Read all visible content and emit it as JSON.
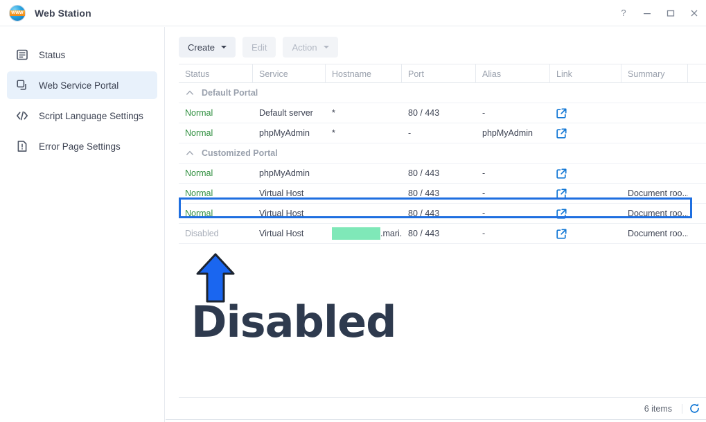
{
  "window": {
    "title": "Web Station",
    "logo_icon": "www-globe-icon",
    "controls": [
      {
        "name": "help-button",
        "icon": "question-mark-icon"
      },
      {
        "name": "minimize-button",
        "icon": "minimize-icon"
      },
      {
        "name": "maximize-button",
        "icon": "maximize-icon"
      },
      {
        "name": "close-button",
        "icon": "close-icon"
      }
    ]
  },
  "sidebar": {
    "items": [
      {
        "label": "Status",
        "icon": "status-list-icon",
        "active": false
      },
      {
        "label": "Web Service Portal",
        "icon": "portal-windows-icon",
        "active": true
      },
      {
        "label": "Script Language Settings",
        "icon": "code-brackets-icon",
        "active": false
      },
      {
        "label": "Error Page Settings",
        "icon": "error-page-icon",
        "active": false
      }
    ]
  },
  "toolbar": {
    "create_label": "Create",
    "edit_label": "Edit",
    "action_label": "Action"
  },
  "table": {
    "columns": [
      "Status",
      "Service",
      "Hostname",
      "Port",
      "Alias",
      "Link",
      "Summary",
      ""
    ],
    "groups": [
      {
        "label": "Default Portal",
        "rows": [
          {
            "status": "Normal",
            "status_type": "normal",
            "service": "Default server",
            "hostname": "*",
            "hostname_redacted": false,
            "port": "80 / 443",
            "alias": "-",
            "link": "external-link-icon",
            "summary": "",
            "selected": false
          },
          {
            "status": "Normal",
            "status_type": "normal",
            "service": "phpMyAdmin",
            "hostname": "*",
            "hostname_redacted": false,
            "port": "-",
            "alias": "phpMyAdmin",
            "link": "external-link-icon",
            "summary": "",
            "selected": false
          }
        ]
      },
      {
        "label": "Customized Portal",
        "rows": [
          {
            "status": "Normal",
            "status_type": "normal",
            "service": "phpMyAdmin",
            "hostname": "",
            "hostname_redacted": false,
            "port": "80 / 443",
            "alias": "-",
            "link": "external-link-icon",
            "summary": "",
            "selected": false
          },
          {
            "status": "Normal",
            "status_type": "normal",
            "service": "Virtual Host",
            "hostname": "",
            "hostname_redacted": false,
            "port": "80 / 443",
            "alias": "-",
            "link": "external-link-icon",
            "summary": "Document roo...",
            "selected": false
          },
          {
            "status": "Normal",
            "status_type": "normal",
            "service": "Virtual Host",
            "hostname": "",
            "hostname_redacted": false,
            "port": "80 / 443",
            "alias": "-",
            "link": "external-link-icon",
            "summary": "Document roo...",
            "selected": false
          },
          {
            "status": "Disabled",
            "status_type": "disabled",
            "service": "Virtual Host",
            "hostname": ".mari...",
            "hostname_redacted": true,
            "port": "80 / 443",
            "alias": "-",
            "link": "external-link-icon",
            "summary": "Document roo...",
            "selected": true
          }
        ]
      }
    ]
  },
  "footer": {
    "items_count": "6 items",
    "refresh_icon": "refresh-icon"
  },
  "annotation": {
    "arrow_icon": "up-arrow-annotation",
    "text": "Disabled"
  },
  "colors": {
    "accent_blue": "#1277d5",
    "highlight_border": "#1f6fe0",
    "status_normal": "#2f8f3f",
    "status_disabled": "#a8aeb9",
    "redaction_green": "#7fe8b8",
    "annotation_text": "#2e3a4e",
    "arrow_blue": "#1a66f0",
    "sidebar_active": "#e8f1fb"
  }
}
